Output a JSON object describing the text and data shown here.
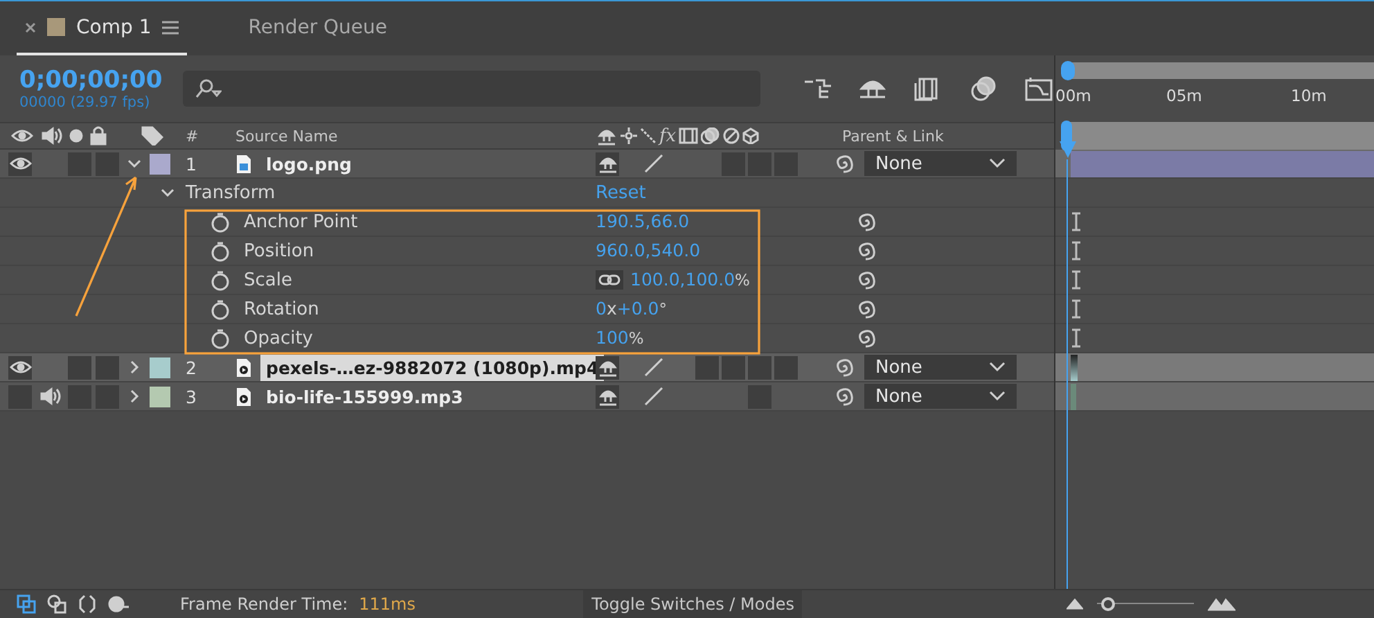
{
  "tabs": [
    {
      "label": "Comp 1",
      "selected": true,
      "closable": true
    },
    {
      "label": "Render Queue",
      "selected": false,
      "closable": false
    }
  ],
  "timecode": "0;00;00;00",
  "frame_info": "00000 (29.97 fps)",
  "columns": {
    "number": "#",
    "source_name": "Source Name",
    "effects": "fx",
    "parent": "Parent & Link"
  },
  "layers": [
    {
      "number": "1",
      "name": "logo.png",
      "kind": "image",
      "color": "#aaa9cc",
      "video": true,
      "audio": false,
      "solo": false,
      "locked": false,
      "expanded": true,
      "selected": false,
      "parent": "None",
      "mode_slots": [
        false,
        true,
        true,
        true
      ],
      "transform": {
        "label": "Transform",
        "reset": "Reset",
        "properties": [
          {
            "name": "Anchor Point",
            "linked": false,
            "parts": [
              {
                "text": "190.5,66.0",
                "kind": "value"
              }
            ]
          },
          {
            "name": "Position",
            "linked": false,
            "parts": [
              {
                "text": "960.0,540.0",
                "kind": "value"
              }
            ]
          },
          {
            "name": "Scale",
            "linked": true,
            "parts": [
              {
                "text": "100.0,100.0",
                "kind": "value"
              },
              {
                "text": "%",
                "kind": "unit"
              }
            ]
          },
          {
            "name": "Rotation",
            "linked": false,
            "parts": [
              {
                "text": "0",
                "kind": "value"
              },
              {
                "text": "x",
                "kind": "sep"
              },
              {
                "text": "+0.0",
                "kind": "value"
              },
              {
                "text": "°",
                "kind": "unit"
              }
            ]
          },
          {
            "name": "Opacity",
            "linked": false,
            "parts": [
              {
                "text": "100",
                "kind": "value"
              },
              {
                "text": "%",
                "kind": "unit"
              }
            ]
          }
        ]
      }
    },
    {
      "number": "2",
      "name": "pexels-…ez-9882072 (1080p).mp4",
      "kind": "video",
      "color": "#a7cccc",
      "video": true,
      "audio": false,
      "solo": false,
      "locked": false,
      "expanded": false,
      "selected": true,
      "parent": "None",
      "mode_slots": [
        true,
        true,
        true,
        true
      ]
    },
    {
      "number": "3",
      "name": "bio-life-155999.mp3",
      "kind": "audio",
      "color": "#b4c9b0",
      "video": false,
      "audio": true,
      "solo": false,
      "locked": false,
      "expanded": false,
      "selected": false,
      "parent": "None",
      "mode_slots": [
        false,
        false,
        true,
        false
      ]
    }
  ],
  "ruler": [
    "00m",
    "05m",
    "10m"
  ],
  "status": {
    "label": "Frame Render Time:",
    "value": "111ms",
    "toggle": "Toggle Switches / Modes",
    "zoom": {
      "level": 0.05
    }
  }
}
